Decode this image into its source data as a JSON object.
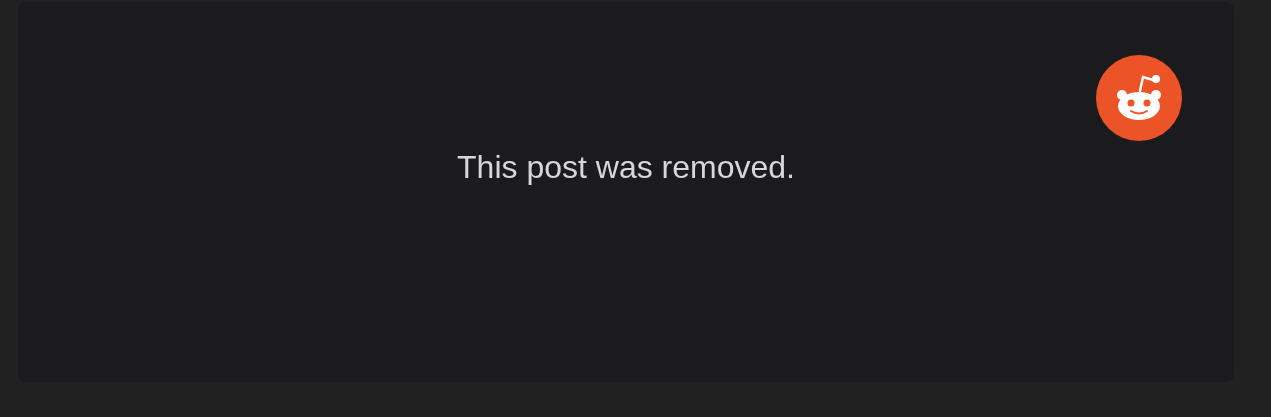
{
  "card": {
    "message": "This post was removed."
  }
}
